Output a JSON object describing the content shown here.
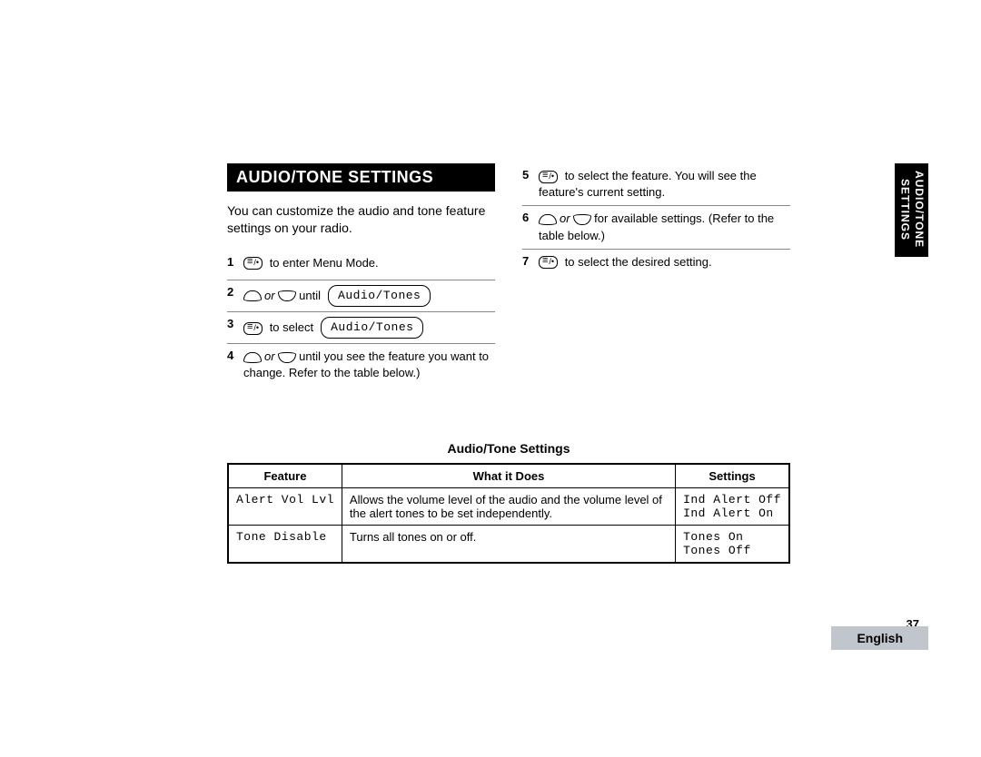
{
  "heading": "AUDIO/TONE SETTINGS",
  "intro": "You can customize the audio and tone feature settings on your radio.",
  "steps_left": [
    {
      "num": "1",
      "text_after": " to enter Menu Mode.",
      "icon": "menu",
      "display": null,
      "wrap": false
    },
    {
      "num": "2",
      "text_after": " until",
      "icon": "updown",
      "display": "Audio/Tones",
      "wrap": false
    },
    {
      "num": "3",
      "text_after": " to select",
      "icon": "menu",
      "display": "Audio/Tones",
      "wrap": false
    },
    {
      "num": "4",
      "text_after": " until you see the feature you want to change. Refer to the table below.)",
      "icon": "updown",
      "display": null,
      "wrap": true
    }
  ],
  "steps_right": [
    {
      "num": "5",
      "text_after": " to select the feature. You will see the feature's current setting.",
      "icon": "menu",
      "display": null,
      "wrap": true
    },
    {
      "num": "6",
      "text_after": " for available settings. (Refer to the table below.)",
      "icon": "updown",
      "display": null,
      "wrap": true
    },
    {
      "num": "7",
      "text_after": " to select the desired setting.",
      "icon": "menu",
      "display": null,
      "wrap": false
    }
  ],
  "table": {
    "title": "Audio/Tone Settings",
    "headers": [
      "Feature",
      "What it Does",
      "Settings"
    ],
    "rows": [
      {
        "feature": "Alert Vol Lvl",
        "desc": "Allows the volume level of the audio and the volume level of the alert tones to be set independently.",
        "settings": [
          "Ind Alert Off",
          "Ind Alert On"
        ]
      },
      {
        "feature": "Tone Disable",
        "desc": "Turns all tones on or off.",
        "settings": [
          "Tones On",
          "Tones Off"
        ]
      }
    ]
  },
  "side_tab": "AUDIO/TONE\nSETTINGS",
  "page_number": "37",
  "language": "English",
  "or_label": "or"
}
